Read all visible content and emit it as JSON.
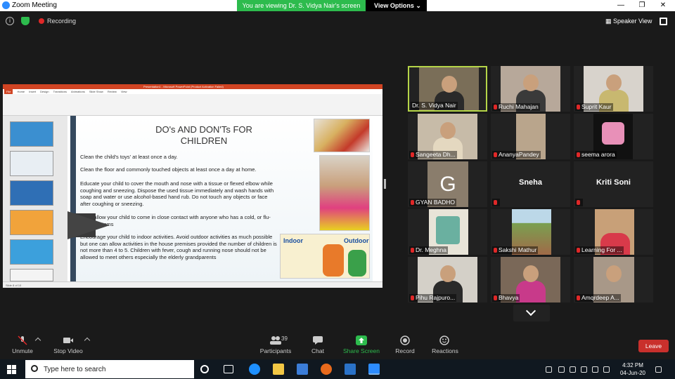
{
  "window": {
    "title": "Zoom Meeting",
    "minimize": "—",
    "restore": "❐",
    "close": "✕"
  },
  "banner": {
    "viewing": "You are viewing Dr. S. Vidya Nair's screen",
    "view_options": "View Options ⌄"
  },
  "topbar": {
    "info": "i",
    "recording": "Recording",
    "speaker_view": "Speaker View"
  },
  "ppt": {
    "window_title": "Presentation1 - Microsoft PowerPoint (Product Activation Failed)",
    "tabs": [
      "File",
      "Home",
      "Insert",
      "Design",
      "Transitions",
      "Animations",
      "Slide Show",
      "Review",
      "View"
    ],
    "slide_title": "DO's AND DON'Ts FOR CHILDREN",
    "bullets": [
      "Clean the child's toys' at least once a day.",
      "Clean the floor and commonly touched objects at least once a day at home.",
      "Educate your child to cover the mouth and nose with a tissue or flexed elbow while coughing and sneezing. Dispose the used tissue immediately and wash hands with soap and water or use alcohol-based hand rub. Do not touch any objects or face after coughing or sneezing.",
      "Don't allow your child to come in close contact with anyone who has a cold, or flu-like symptoms",
      "Encourage your child to indoor activities. Avoid outdoor activities as much possible but one can allow activities in the house premises provided the number of children is not more than 4 to 5. Children with fever, cough and running nose should not be allowed to meet others especially the elderly grandparents"
    ],
    "image_labels": {
      "indoor": "Indoor",
      "outdoor": "Outdoor"
    },
    "status": "Slide 8 of 10"
  },
  "participants": [
    {
      "name": "Dr. S. Vidya Nair",
      "muted": false,
      "video": true,
      "active": true
    },
    {
      "name": "Ruchi Mahajan",
      "muted": true,
      "video": true
    },
    {
      "name": "Suprit Kaur",
      "muted": true,
      "video": true
    },
    {
      "name": "Sangeeta Dh...",
      "muted": true,
      "video": true
    },
    {
      "name": "AnanyaPandey",
      "muted": true,
      "video": true
    },
    {
      "name": "seema arora",
      "muted": true,
      "video": true
    },
    {
      "name": "GYAN BADHO",
      "muted": true,
      "video": false,
      "initial": "G"
    },
    {
      "name": "Sneha",
      "muted": true,
      "video": false
    },
    {
      "name": "Kriti Soni",
      "muted": true,
      "video": false
    },
    {
      "name": "Dr. Meghna",
      "muted": true,
      "video": true
    },
    {
      "name": "Sakshi Mathur",
      "muted": true,
      "video": true
    },
    {
      "name": "Learning For ...",
      "muted": true,
      "video": true
    },
    {
      "name": "Pihu Rajpuro...",
      "muted": true,
      "video": true
    },
    {
      "name": "Bhavya",
      "muted": true,
      "video": true
    },
    {
      "name": "Amqrdeep A...",
      "muted": true,
      "video": true
    }
  ],
  "toolbar": {
    "unmute": "Unmute",
    "stop_video": "Stop Video",
    "participants": "Participants",
    "participants_count": "39",
    "chat": "Chat",
    "share_screen": "Share Screen",
    "record": "Record",
    "reactions": "Reactions",
    "leave": "Leave"
  },
  "taskbar": {
    "search_placeholder": "Type here to search",
    "time": "4:32 PM",
    "date": "04-Jun-20"
  },
  "colors": {
    "accent_green": "#2dbb4d",
    "leave_red": "#c9302c",
    "active_speaker": "#b5d548",
    "mute_red": "#e02828"
  }
}
